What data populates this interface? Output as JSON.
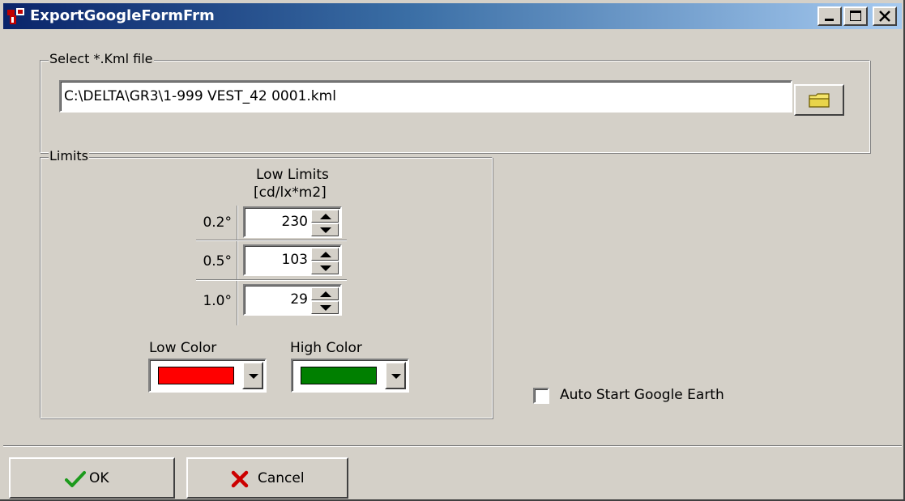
{
  "window": {
    "title": "ExportGoogleFormFrm",
    "controls": {
      "minimize": "_",
      "maximize": "□",
      "close": "×"
    }
  },
  "file_group": {
    "legend": "Select *.Kml file",
    "path_value": "C:\\DELTA\\GR3\\1-999 VEST_42 0001.kml",
    "browse_icon": "folder-icon"
  },
  "limits_group": {
    "legend": "Limits",
    "header_line1": "Low Limits",
    "header_line2": "[cd/lx*m2]",
    "rows": [
      {
        "angle": "0.2°",
        "value": "230"
      },
      {
        "angle": "0.5°",
        "value": "103"
      },
      {
        "angle": "1.0°",
        "value": "29"
      }
    ],
    "low_color_label": "Low Color",
    "high_color_label": "High Color",
    "low_color": "#ff0000",
    "high_color": "#007f00"
  },
  "auto_start": {
    "label": "Auto Start Google Earth",
    "checked": false
  },
  "buttons": {
    "ok_label": "OK",
    "cancel_label": "Cancel"
  },
  "colors": {
    "face": "#d4d0c8",
    "title_start": "#0a246a",
    "title_end": "#a6caf0"
  }
}
